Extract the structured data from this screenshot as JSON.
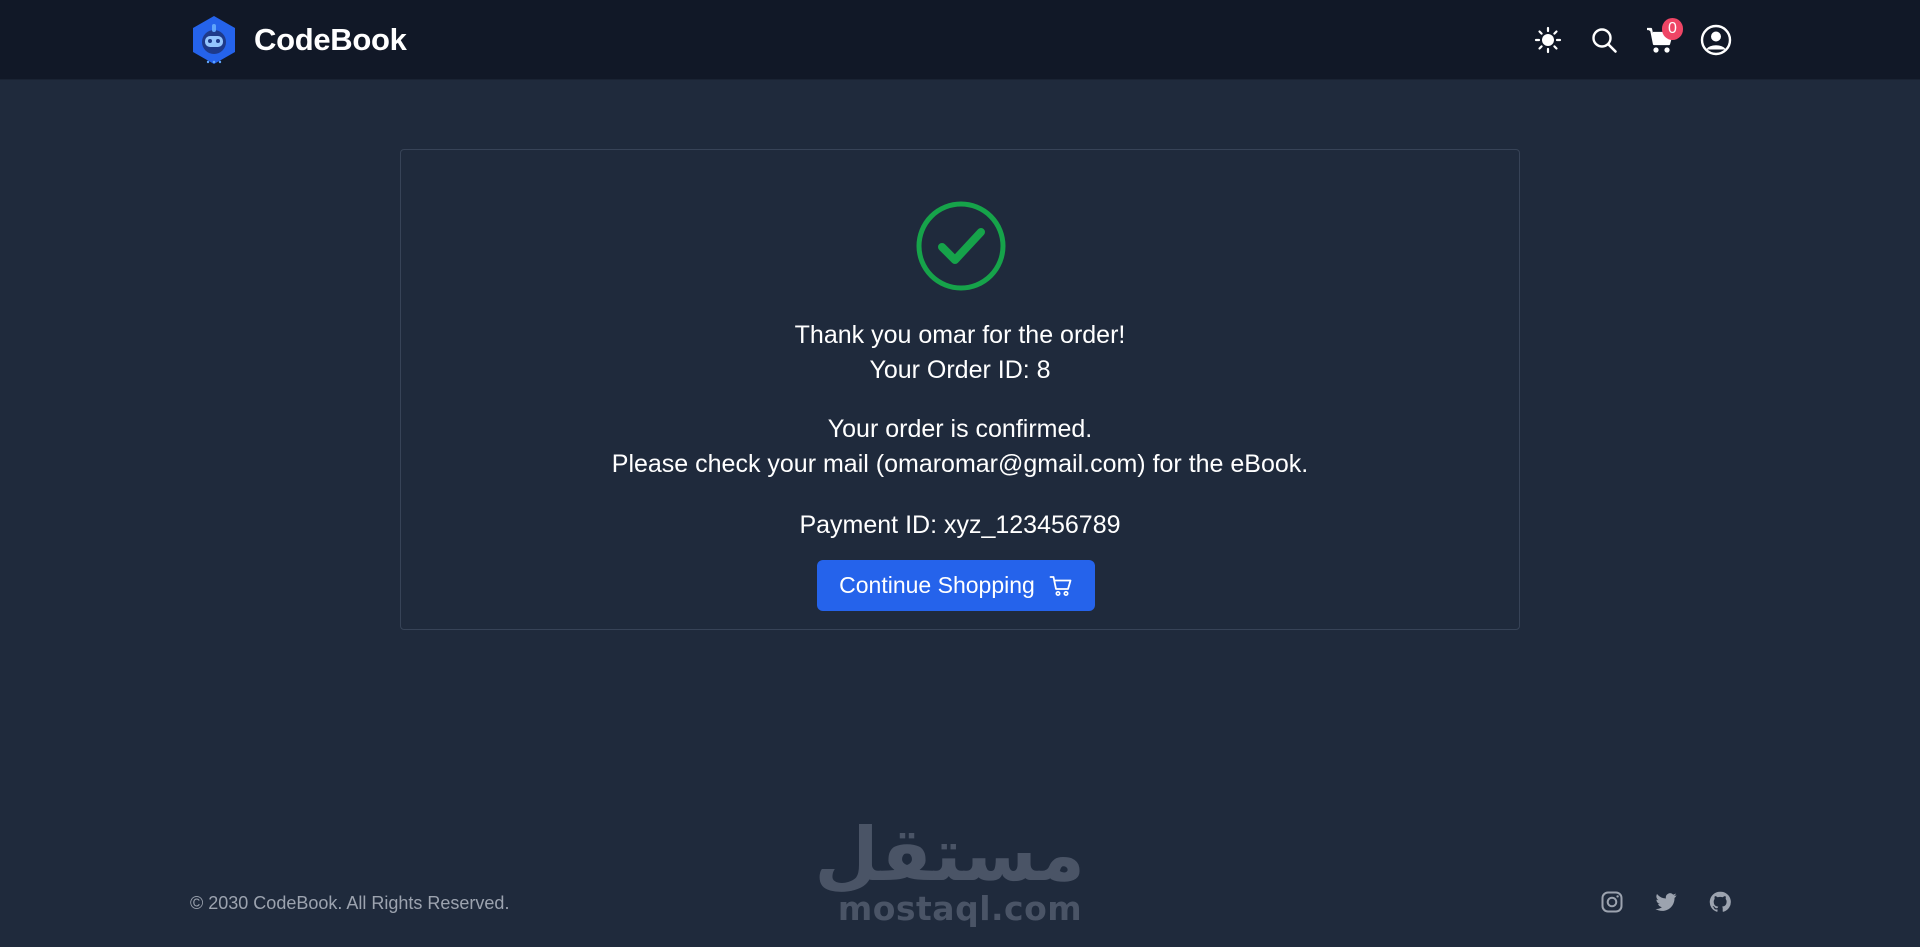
{
  "header": {
    "brand_name": "CodeBook",
    "cart_count": "0",
    "icons": [
      "theme-toggle-sun-icon",
      "search-icon",
      "cart-icon",
      "user-account-icon"
    ]
  },
  "order_success": {
    "thank_you": "Thank you omar for the order!",
    "order_id": "Your Order ID: 8",
    "confirmed": "Your order is confirmed.",
    "check_mail": "Please check your mail (omaromar@gmail.com) for the eBook.",
    "payment_id": "Payment ID: xyz_123456789",
    "continue_label": "Continue Shopping",
    "success_color": "#16a34a"
  },
  "watermark": {
    "arabic": "مستقل",
    "latin": "mostaql.com"
  },
  "footer": {
    "copyright": "© 2030 CodeBook. All Rights Reserved.",
    "social": [
      "instagram-icon",
      "twitter-icon",
      "github-icon"
    ]
  },
  "colors": {
    "background": "#1f2a3c",
    "navbar": "#111827",
    "primary_button": "#2563eb",
    "badge": "#ef4565"
  }
}
